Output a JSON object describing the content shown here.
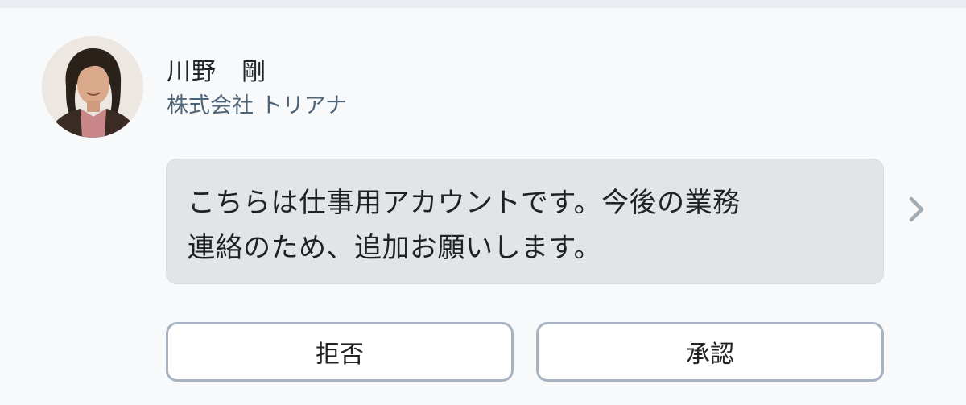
{
  "contact": {
    "name": "川野　剛",
    "company": "株式会社 トリアナ",
    "avatar_icon": "person-photo-avatar"
  },
  "message": {
    "line1": "こちらは仕事用アカウントです。今後の業務",
    "line2": "連絡のため、追加お願いします。"
  },
  "actions": {
    "reject_label": "拒否",
    "approve_label": "承認"
  },
  "icons": {
    "chevron": "chevron-right-icon"
  },
  "colors": {
    "background": "#f7f9fb",
    "bubble": "#e2e4e7",
    "company_text": "#4f6577",
    "button_border": "#a7b3c1"
  }
}
